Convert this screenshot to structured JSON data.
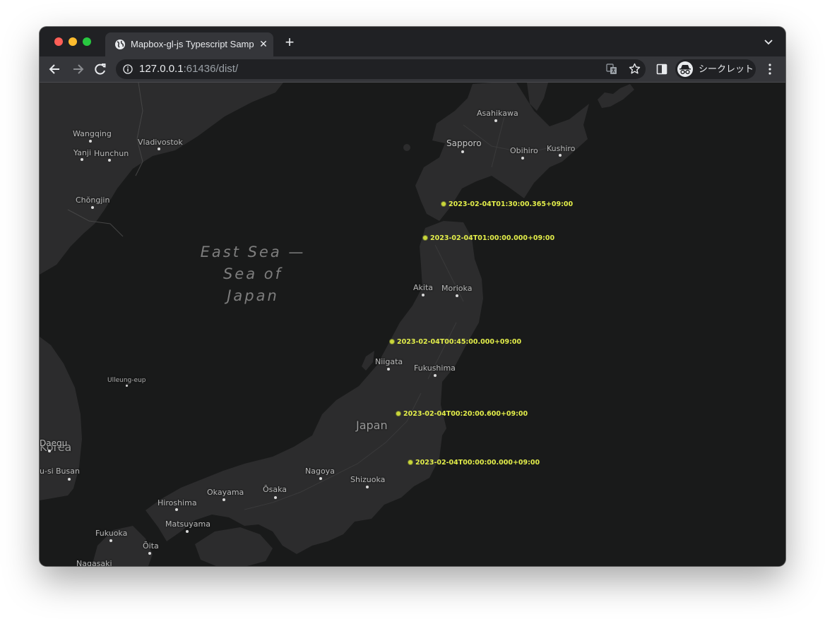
{
  "window": {
    "traffic_lights": [
      "close",
      "minimize",
      "zoom"
    ]
  },
  "tabs": [
    {
      "title": "Mapbox-gl-js Typescript Sample",
      "active": true,
      "close_label": "✕"
    }
  ],
  "new_tab_label": "+",
  "toolbar": {
    "url_host": "127.0.0.1",
    "url_rest": ":61436/dist/",
    "profile_label": "シークレット"
  },
  "map": {
    "sea_label": "East Sea — Sea of Japan",
    "country_labels": [
      "Japan",
      "Korea"
    ],
    "places": {
      "asahikawa": "Asahikawa",
      "sapporo": "Sapporo",
      "obihiro": "Obihiro",
      "kushiro": "Kushiro",
      "wangqing": "Wangqing",
      "yanji": "Yanji",
      "hunchun": "Hunchun",
      "vladivostok": "Vladivostok",
      "chongjin": "Chŏngjin",
      "akita": "Akita",
      "morioka": "Morioka",
      "niigata": "Niigata",
      "fukushima": "Fukushima",
      "ulleung": "Ulleung-eup",
      "daegu": "Daegu",
      "busan": "Busan",
      "usi": "u-si",
      "nagoya": "Nagoya",
      "shizuoka": "Shizuoka",
      "okayama": "Okayama",
      "osaka": "Ōsaka",
      "hiroshima": "Hiroshima",
      "matsuyama": "Matsuyama",
      "fukuoka": "Fukuoka",
      "oita": "Ōita",
      "nagasaki": "Nagasaki"
    },
    "markers": [
      "2023-02-04T01:30:00.365+09:00",
      "2023-02-04T01:00:00.000+09:00",
      "2023-02-04T00:45:00.000+09:00",
      "2023-02-04T00:20:00.600+09:00",
      "2023-02-04T00:00:00.000+09:00"
    ],
    "colors": {
      "land": "#2c2c2d",
      "water": "#191a1a",
      "marker": "#e3ee4a"
    }
  }
}
